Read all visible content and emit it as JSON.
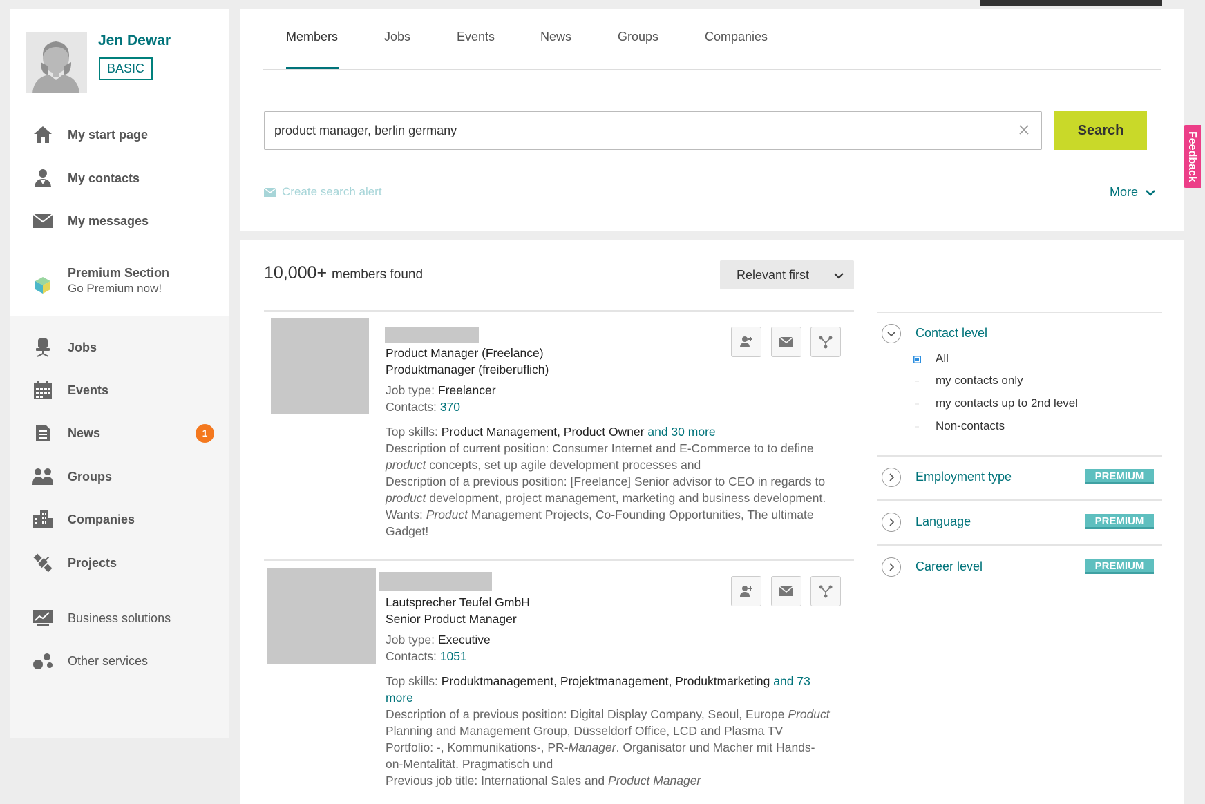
{
  "profile": {
    "name": "Jen Dewar",
    "membership": "BASIC"
  },
  "sidebar": {
    "items": [
      {
        "label": "My start page",
        "icon": "home-icon"
      },
      {
        "label": "My contacts",
        "icon": "contacts-icon"
      },
      {
        "label": "My messages",
        "icon": "envelope-icon"
      },
      {
        "label": "Premium Section",
        "sub": "Go Premium now!",
        "icon": "premium-cube-icon"
      },
      {
        "label": "Jobs",
        "icon": "office-chair-icon"
      },
      {
        "label": "Events",
        "icon": "calendar-icon"
      },
      {
        "label": "News",
        "icon": "document-icon",
        "badge": "1"
      },
      {
        "label": "Groups",
        "icon": "group-icon"
      },
      {
        "label": "Companies",
        "icon": "building-icon"
      },
      {
        "label": "Projects",
        "icon": "satellite-icon"
      },
      {
        "label": "Business solutions",
        "icon": "chart-monitor-icon"
      },
      {
        "label": "Other services",
        "icon": "dots-icon"
      }
    ]
  },
  "tabs": [
    "Members",
    "Jobs",
    "Events",
    "News",
    "Groups",
    "Companies"
  ],
  "search": {
    "value": "product manager, berlin germany",
    "button": "Search",
    "alert_label": "Create search alert",
    "more_label": "More"
  },
  "feedback_label": "Feedback",
  "results": {
    "count": "10,000+",
    "count_suffix": "members found",
    "sort": "Relevant first",
    "items": [
      {
        "title": "Product Manager (Freelance)",
        "subtitle": "Produktmanager (freiberuflich)",
        "job_type_label": "Job type:",
        "job_type": "Freelancer",
        "contacts_label": "Contacts:",
        "contacts": "370",
        "skills_label": "Top skills:",
        "skills": "Product Management, Product Owner",
        "skills_more": "and 30 more",
        "desc1_a": "Description of current position: Consumer Internet and E-Commerce to to define",
        "desc1_b_em": "product",
        "desc1_b": "concepts, set up agile development processes and",
        "desc2_a": "Description of a previous position: [Freelance] Senior advisor to CEO in regards to",
        "desc2_b_em": "product",
        "desc2_b": "development, project management, marketing and business development.",
        "wants_label": "Wants:",
        "wants_em": "Product",
        "wants_a": "Management Projects, Co-Founding Opportunities, The ultimate",
        "wants_b": "Gadget!"
      },
      {
        "title": "Lautsprecher Teufel GmbH",
        "subtitle": "Senior Product Manager",
        "job_type_label": "Job type:",
        "job_type": "Executive",
        "contacts_label": "Contacts:",
        "contacts": "1051",
        "skills_label": "Top skills:",
        "skills": "Produktmanagement, Projektmanagement, Produktmarketing",
        "skills_more_a": "and 73",
        "skills_more_b": "more",
        "desc1_a": "Description of a previous position: Digital Display Company, Seoul, Europe",
        "desc1_a_em": "Product",
        "desc1_b": "Planning and Management Group, Düsseldorf Office, LCD and Plasma TV",
        "desc1_c_a": "Portfolio: -, Kommunikations-, PR-",
        "desc1_c_em": "Manager",
        "desc1_c_b": ". Organisator und Macher mit Hands-",
        "desc1_d": "on-Mentalität. Pragmatisch und",
        "prev_title_label": "Previous job title: International Sales and",
        "prev_title_em": "Product Manager"
      }
    ]
  },
  "filters": {
    "contact_level": {
      "label": "Contact level",
      "options": [
        "All",
        "my contacts only",
        "my contacts up to 2nd level",
        "Non-contacts"
      ],
      "selected": "All"
    },
    "employment_type": {
      "label": "Employment type",
      "badge": "PREMIUM"
    },
    "language": {
      "label": "Language",
      "badge": "PREMIUM"
    },
    "career_level": {
      "label": "Career level",
      "badge": "PREMIUM"
    }
  },
  "colors": {
    "accent": "#00737a",
    "search_button": "#c9d929",
    "badge_orange": "#f4781e",
    "premium": "#5ebfbf",
    "feedback": "#ec3e88"
  }
}
